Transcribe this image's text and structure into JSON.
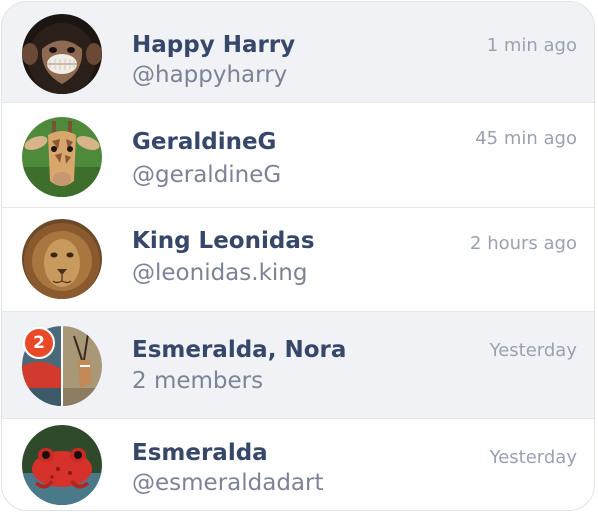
{
  "conversations": [
    {
      "name": "Happy Harry",
      "subtitle": "@happyharry",
      "time": "1 min ago",
      "avatar": "chimpanzee-avatar"
    },
    {
      "name": "GeraldineG",
      "subtitle": "@geraldineG",
      "time": "45 min ago",
      "avatar": "giraffe-avatar"
    },
    {
      "name": "King Leonidas",
      "subtitle": "@leonidas.king",
      "time": "2 hours ago",
      "avatar": "lion-avatar"
    },
    {
      "name": "Esmeralda, Nora",
      "subtitle": "2 members",
      "time": "Yesterday",
      "avatar": "group-avatar",
      "unread": "2"
    },
    {
      "name": "Esmeralda",
      "subtitle": "@esmeraldadart",
      "time": "Yesterday",
      "avatar": "frog-avatar"
    }
  ],
  "colors": {
    "name": "#36476a",
    "subtitle": "#7b8496",
    "time": "#9aa2b1",
    "highlight_row": "#f0f2f5",
    "badge": "#e84a28"
  }
}
